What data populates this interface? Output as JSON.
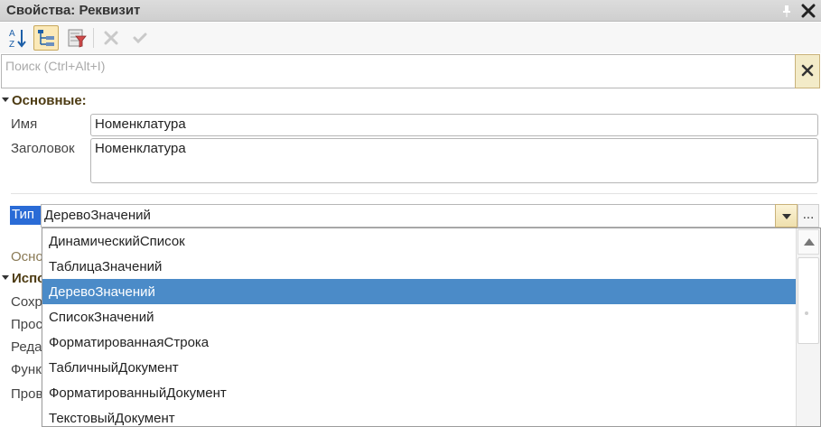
{
  "window": {
    "title": "Свойства: Реквизит"
  },
  "toolbar": {
    "sort_icon": "sort-az-icon",
    "tree_icon": "tree-view-icon",
    "filter_icon": "filter-icon",
    "delete_icon": "delete-x-icon",
    "confirm_icon": "checkmark-icon"
  },
  "search": {
    "placeholder": "Поиск (Ctrl+Alt+I)",
    "value": ""
  },
  "group_main": {
    "title": "Основные:"
  },
  "fields": {
    "name_label": "Имя",
    "name_value": "Номенклатура",
    "caption_label": "Заголовок",
    "caption_value": "Номенклатура",
    "type_label": "Тип",
    "type_value": "ДеревоЗначений",
    "more_label": "..."
  },
  "obscured": {
    "partial_1": "Осно",
    "group_use": "Испо",
    "row_1": "Сохр",
    "row_2": "Прос",
    "row_3": "Реда",
    "row_4": "Функ",
    "row_5": "Пров"
  },
  "dropdown": {
    "selected_index": 2,
    "options": [
      "ДинамическийСписок",
      "ТаблицаЗначений",
      "ДеревоЗначений",
      "СписокЗначений",
      "ФорматированнаяСтрока",
      "ТабличныйДокумент",
      "ФорматированныйДокумент",
      "ТекстовыйДокумент"
    ]
  },
  "colors": {
    "accent_selection": "#4b8bc8",
    "label_highlight": "#2a6bd6",
    "group_title": "#4d3b12",
    "button_yellow": "#f3ebc8"
  }
}
